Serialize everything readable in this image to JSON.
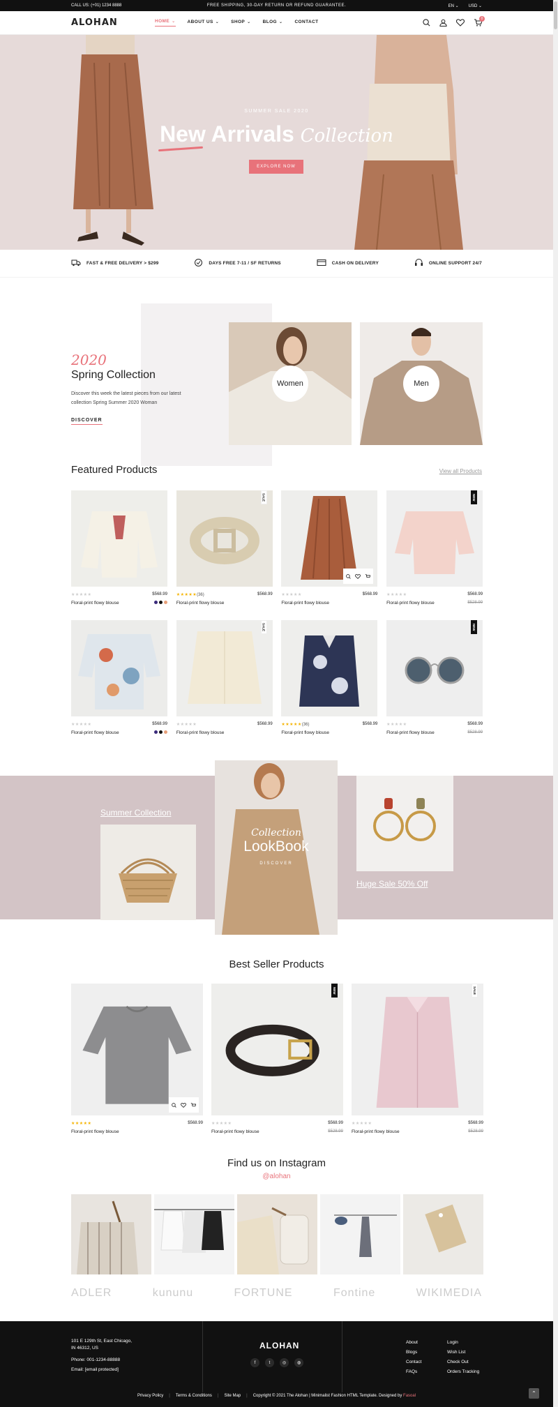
{
  "topbar": {
    "call": "CALL US: (+01) 1234 8888",
    "shipping": "FREE SHIPPING, 30-DAY RETURN OR REFUND GUARANTEE.",
    "language": "EN",
    "currency": "USD"
  },
  "header": {
    "logo": "ALOHAN",
    "nav": [
      {
        "label": "HOME",
        "active": true,
        "dropdown": true
      },
      {
        "label": "ABOUT US",
        "active": false,
        "dropdown": true
      },
      {
        "label": "SHOP",
        "active": false,
        "dropdown": true
      },
      {
        "label": "BLOG",
        "active": false,
        "dropdown": true
      },
      {
        "label": "CONTACT",
        "active": false,
        "dropdown": false
      }
    ],
    "cart_count": "0",
    "icons": [
      "search-icon",
      "user-icon",
      "heart-icon",
      "cart-icon"
    ]
  },
  "hero": {
    "kicker": "SUMMER SALE 2020",
    "title_new": "New",
    "title_rest": "Arrivals",
    "title_script": "Collection",
    "cta": "EXPLORE NOW"
  },
  "features": [
    {
      "icon": "truck-icon",
      "label": "FAST & FREE DELIVERY > $299"
    },
    {
      "icon": "return-icon",
      "label": "DAYS FREE 7-11 / SF RETURNS"
    },
    {
      "icon": "card-icon",
      "label": "CASH ON DELIVERY"
    },
    {
      "icon": "headset-icon",
      "label": "ONLINE SUPPORT 24/7"
    }
  ],
  "spring": {
    "year": "2020",
    "title": "Spring Collection",
    "text": "Discover this week the latest pieces from our latest collection Spring Summer 2020 Woman",
    "cta": "DISCOVER",
    "categories": [
      "Women",
      "Men"
    ]
  },
  "featured": {
    "title": "Featured Products",
    "view_all": "View all Products",
    "products": [
      {
        "name": "Floral-print flowy blouse",
        "price": "$568.99",
        "old": "",
        "rating": 0,
        "reviews": "",
        "tag": "",
        "swatches": [
          "#3a2a7a",
          "#111111",
          "#e8a07a"
        ]
      },
      {
        "name": "Floral-print flowy blouse",
        "price": "$568.99",
        "old": "",
        "rating": 5,
        "reviews": "(36)",
        "tag": "SALE",
        "swatches": []
      },
      {
        "name": "Floral-print flowy blouse",
        "price": "$568.99",
        "old": "",
        "rating": 0,
        "reviews": "",
        "tag": "",
        "swatches": []
      },
      {
        "name": "Floral-print flowy blouse",
        "price": "$568.99",
        "old": "$528.99",
        "rating": 0,
        "reviews": "",
        "tag": "NEW",
        "swatches": []
      },
      {
        "name": "Floral-print flowy blouse",
        "price": "$568.99",
        "old": "",
        "rating": 0,
        "reviews": "",
        "tag": "",
        "swatches": [
          "#3a2a7a",
          "#111111",
          "#e8a07a"
        ]
      },
      {
        "name": "Floral-print flowy blouse",
        "price": "$568.99",
        "old": "",
        "rating": 0,
        "reviews": "",
        "tag": "SALE",
        "swatches": []
      },
      {
        "name": "Floral-print flowy blouse",
        "price": "$568.99",
        "old": "",
        "rating": 5,
        "reviews": "(36)",
        "tag": "",
        "swatches": []
      },
      {
        "name": "Floral-print flowy blouse",
        "price": "$568.99",
        "old": "$528.99",
        "rating": 0,
        "reviews": "",
        "tag": "NEW",
        "swatches": []
      }
    ]
  },
  "lookbook": {
    "script": "Collection",
    "title": "LookBook",
    "cta": "DISCOVER",
    "summer": "Summer Collection",
    "sale": "Huge Sale 50% Off"
  },
  "bestseller": {
    "title": "Best Seller Products",
    "products": [
      {
        "name": "Floral-print flowy blouse",
        "price": "$568.99",
        "old": "",
        "rating": 5,
        "tag": ""
      },
      {
        "name": "Floral-print flowy blouse",
        "price": "$568.99",
        "old": "$528.99",
        "rating": 0,
        "tag": "NEW"
      },
      {
        "name": "Floral-print flowy blouse",
        "price": "$568.99",
        "old": "$528.99",
        "rating": 0,
        "tag": "SALE"
      }
    ]
  },
  "instagram": {
    "title": "Find us on Instagram",
    "handle": "@alohan"
  },
  "brands": [
    "ADLER",
    "kununu",
    "FORTUNE",
    "Fontine",
    "WIKIMEDIA"
  ],
  "footer": {
    "address1": "101 E 129th St, East Chicago,",
    "address2": "IN 46312, US",
    "phone": "Phone: 001-1234-88888",
    "email": "Email: [email protected]",
    "logo": "ALOHAN",
    "links1": [
      "About",
      "Blogs",
      "Contact",
      "FAQs"
    ],
    "links2": [
      "Login",
      "Wish List",
      "Check Out",
      "Orders Tracking"
    ],
    "bottom": [
      "Privacy Policy",
      "Terms & Conditions",
      "Site Map"
    ],
    "copyright": "Copyright © 2021 The Alohan | Minimalist Fashion HTML Template. Designed by",
    "designer": "Fasoal"
  },
  "colors": {
    "accent": "#e8727a",
    "hero_bg": "#e6dad9",
    "lookbook_bg": "#d3c4c6",
    "footer_bg": "#111111"
  }
}
